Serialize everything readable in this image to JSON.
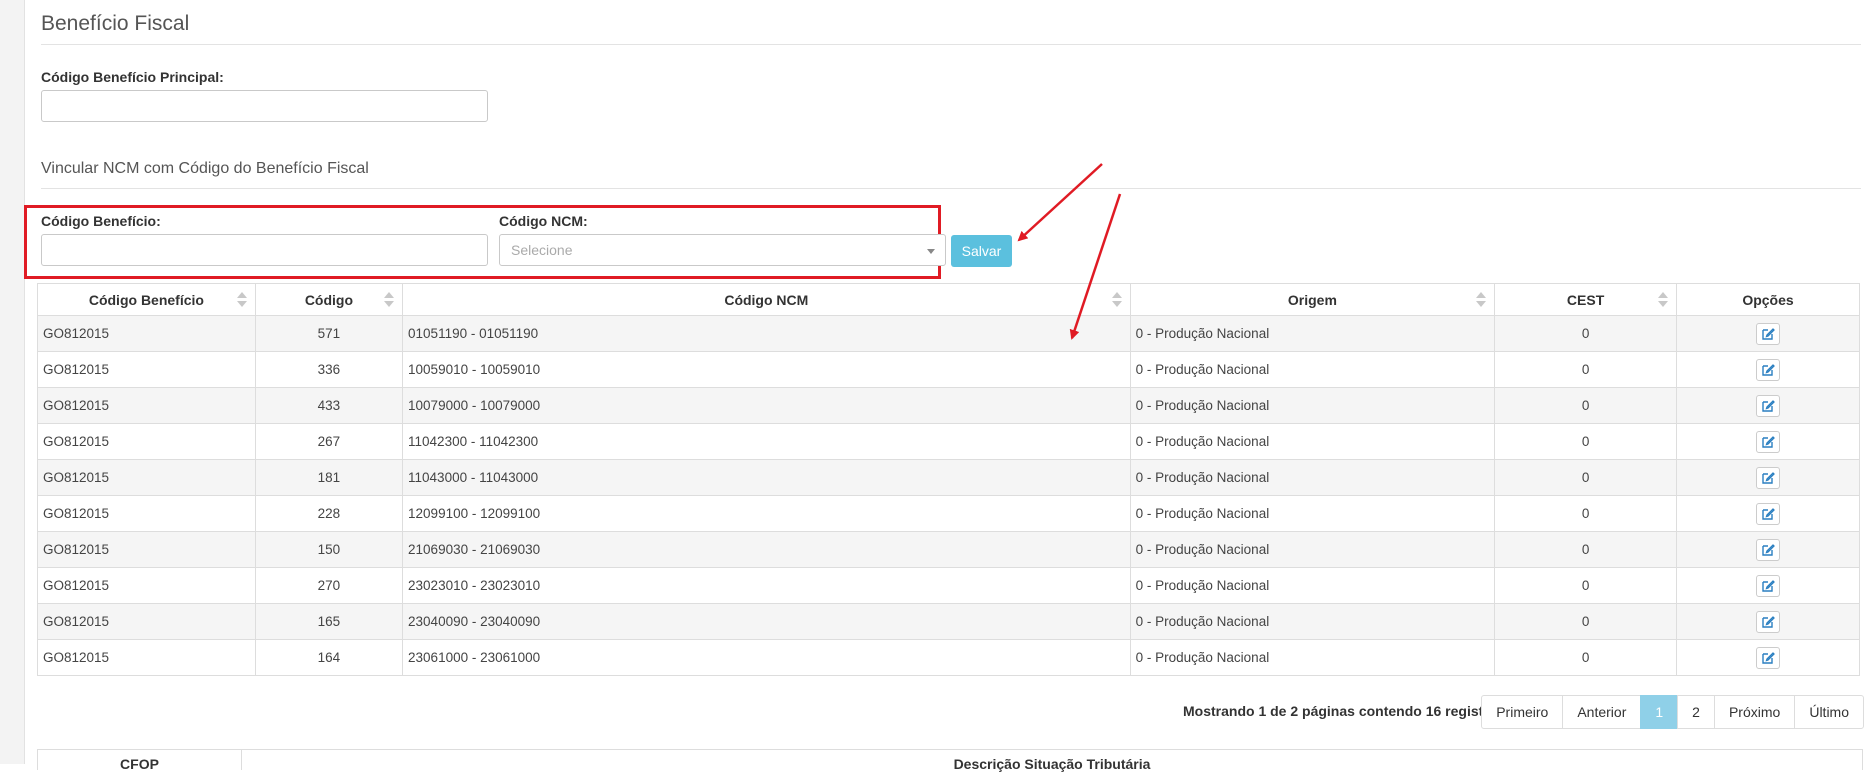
{
  "section1": {
    "title": "Benefício Fiscal",
    "codigo_principal_label": "Código Benefício Principal:",
    "codigo_principal_value": ""
  },
  "section2": {
    "title": "Vincular NCM com Código do Benefício Fiscal",
    "codigo_beneficio_label": "Código Benefício:",
    "codigo_beneficio_value": "",
    "codigo_ncm_label": "Código NCM:",
    "codigo_ncm_placeholder": "Selecione",
    "save_label": "Salvar"
  },
  "table": {
    "headers": [
      "Código Benefício",
      "Código",
      "Código NCM",
      "Origem",
      "CEST",
      "Opções"
    ],
    "rows": [
      {
        "beneficio": "GO812015",
        "codigo": "571",
        "ncm": "01051190 - 01051190",
        "origem": "0 - Produção Nacional",
        "cest": "0"
      },
      {
        "beneficio": "GO812015",
        "codigo": "336",
        "ncm": "10059010 - 10059010",
        "origem": "0 - Produção Nacional",
        "cest": "0"
      },
      {
        "beneficio": "GO812015",
        "codigo": "433",
        "ncm": "10079000 - 10079000",
        "origem": "0 - Produção Nacional",
        "cest": "0"
      },
      {
        "beneficio": "GO812015",
        "codigo": "267",
        "ncm": "11042300 - 11042300",
        "origem": "0 - Produção Nacional",
        "cest": "0"
      },
      {
        "beneficio": "GO812015",
        "codigo": "181",
        "ncm": "11043000 - 11043000",
        "origem": "0 - Produção Nacional",
        "cest": "0"
      },
      {
        "beneficio": "GO812015",
        "codigo": "228",
        "ncm": "12099100 - 12099100",
        "origem": "0 - Produção Nacional",
        "cest": "0"
      },
      {
        "beneficio": "GO812015",
        "codigo": "150",
        "ncm": "21069030 - 21069030",
        "origem": "0 - Produção Nacional",
        "cest": "0"
      },
      {
        "beneficio": "GO812015",
        "codigo": "270",
        "ncm": "23023010 - 23023010",
        "origem": "0 - Produção Nacional",
        "cest": "0"
      },
      {
        "beneficio": "GO812015",
        "codigo": "165",
        "ncm": "23040090 - 23040090",
        "origem": "0 - Produção Nacional",
        "cest": "0"
      },
      {
        "beneficio": "GO812015",
        "codigo": "164",
        "ncm": "23061000 - 23061000",
        "origem": "0 - Produção Nacional",
        "cest": "0"
      }
    ],
    "edit_icon": "edit-icon"
  },
  "pagination": {
    "info": "Mostrando 1 de 2 páginas contendo 16 registros.",
    "first": "Primeiro",
    "prev": "Anterior",
    "page1": "1",
    "page2": "2",
    "next": "Próximo",
    "last": "Último",
    "active_page": 1
  },
  "second_table": {
    "col1": "CFOP",
    "col2": "Descrição Situação Tributária"
  },
  "colors": {
    "accent": "#5bc0de",
    "annotation": "#e01b24"
  }
}
